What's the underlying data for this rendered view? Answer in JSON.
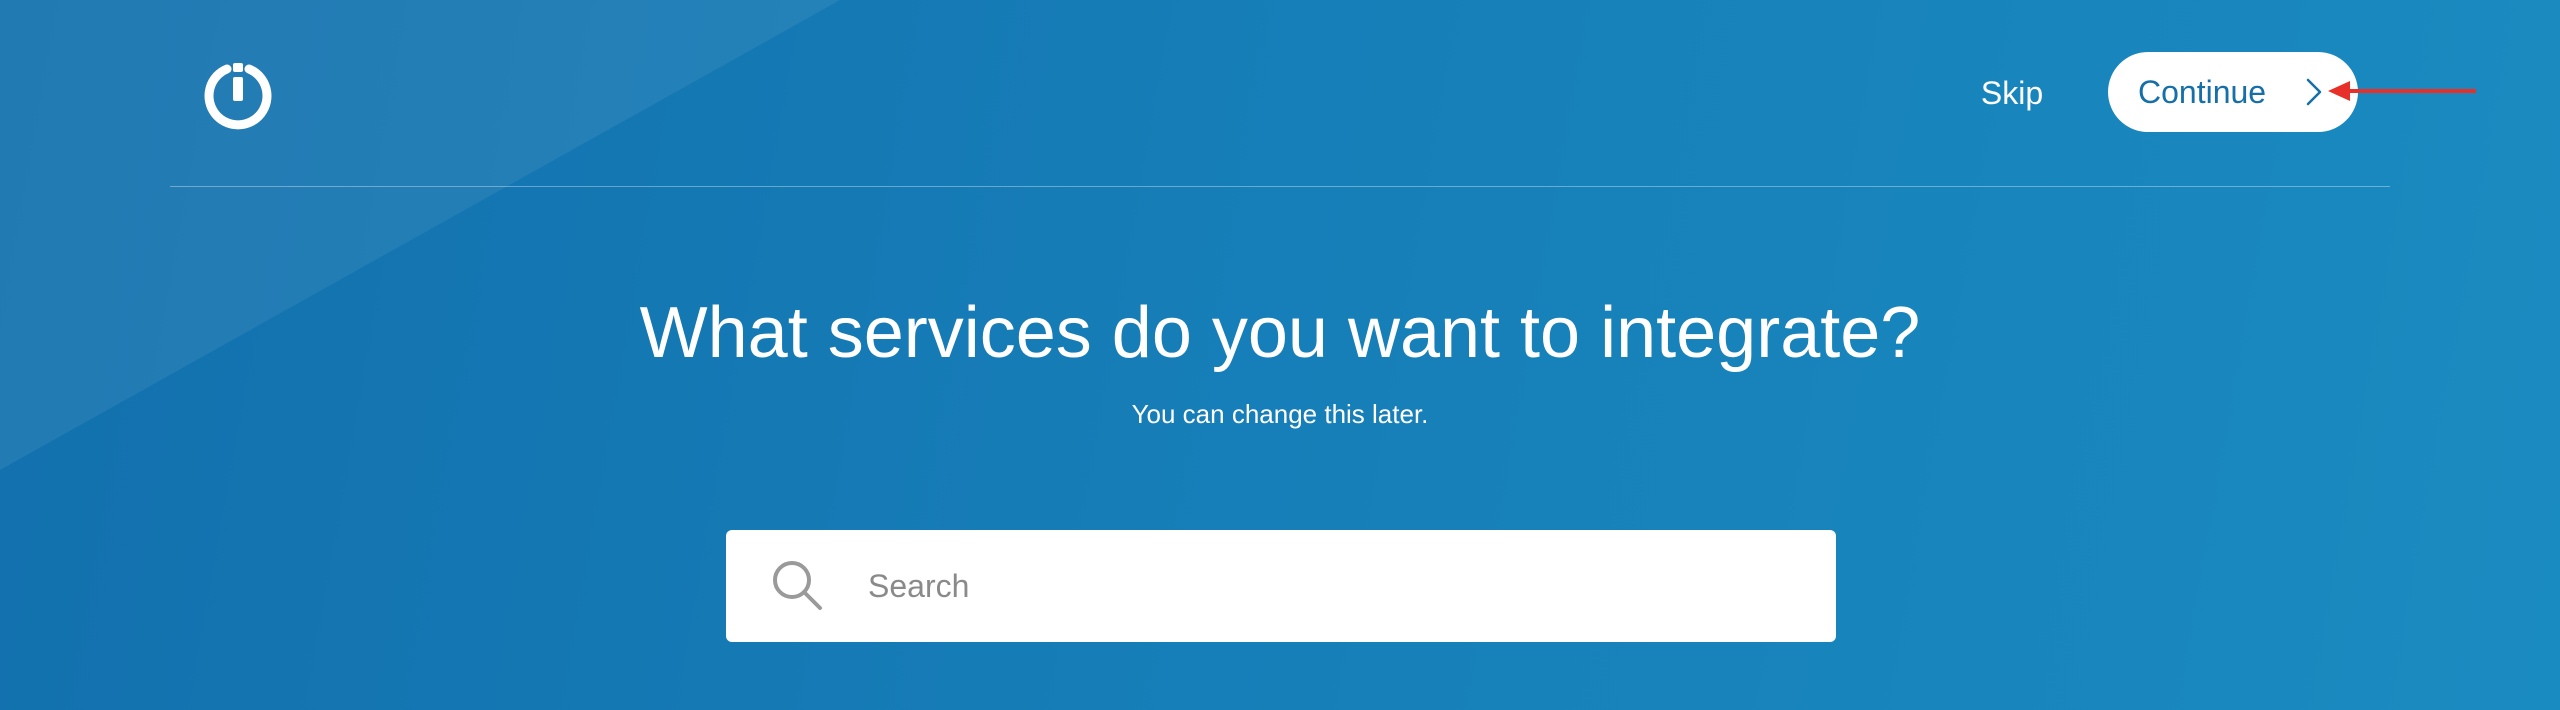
{
  "header": {
    "logo_icon": "power-i-icon",
    "skip_label": "Skip",
    "continue_label": "Continue",
    "continue_icon": "chevron-right-icon"
  },
  "main": {
    "title": "What services do you want to integrate?",
    "subtitle": "You can change this later."
  },
  "search": {
    "icon": "search-icon",
    "placeholder": "Search",
    "value": ""
  },
  "annotation": {
    "icon": "arrow-left-icon",
    "color": "#e8302a"
  },
  "colors": {
    "background_start": "#1270ad",
    "background_end": "#1a8bc0",
    "button_text": "#166fa8"
  }
}
